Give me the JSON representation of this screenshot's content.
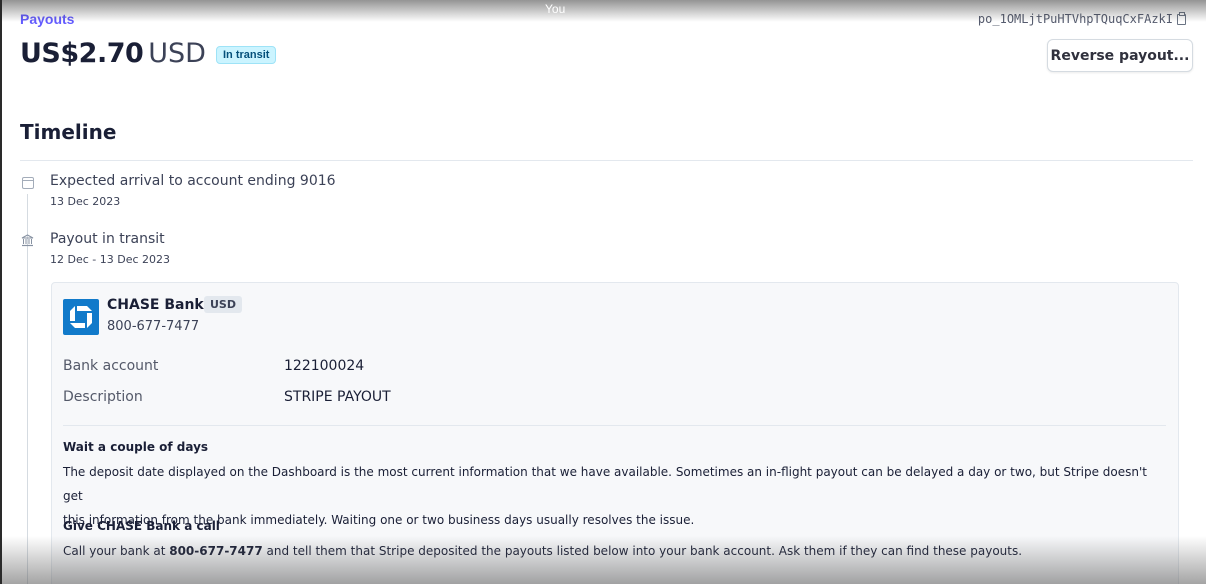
{
  "overlay": {
    "participant_label": "You"
  },
  "header": {
    "breadcrumb": "Payouts",
    "payout_id": "po_1OMLjtPuHTVhpTQuqCxFAzkI",
    "amount": "US$2.70",
    "currency": "USD",
    "status": "In transit",
    "reverse_button_label": "Reverse payout..."
  },
  "timeline": {
    "title": "Timeline",
    "events": [
      {
        "icon": "calendar-icon",
        "title": "Expected arrival to account ending 9016",
        "date": "13 Dec 2023"
      },
      {
        "icon": "bank-icon",
        "title": "Payout in transit",
        "date": "12 Dec - 13 Dec 2023"
      }
    ]
  },
  "bank": {
    "logo_icon": "chase-logo-icon",
    "name": "CHASE Bank",
    "currency": "USD",
    "phone": "800-677-7477",
    "fields": [
      {
        "label": "Bank account",
        "value": "122100024"
      },
      {
        "label": "Description",
        "value": "STRIPE PAYOUT"
      }
    ]
  },
  "help": {
    "wait_heading": "Wait a couple of days",
    "wait_line1": "The deposit date displayed on the Dashboard is the most current information that we have available. Sometimes an in-flight payout can be delayed a day or two, but Stripe doesn't get",
    "wait_line2": "this information from the bank immediately. Waiting one or two business days usually resolves the issue.",
    "call_heading": "Give CHASE Bank a call",
    "call_prefix": "Call your bank at ",
    "call_phone": "800-677-7477",
    "call_suffix": " and tell them that Stripe deposited the payouts listed below into your bank account. Ask them if they can find these payouts."
  },
  "colors": {
    "accent": "#635bff",
    "badge_bg": "#cbf4ff",
    "chase_blue": "#117aca"
  }
}
